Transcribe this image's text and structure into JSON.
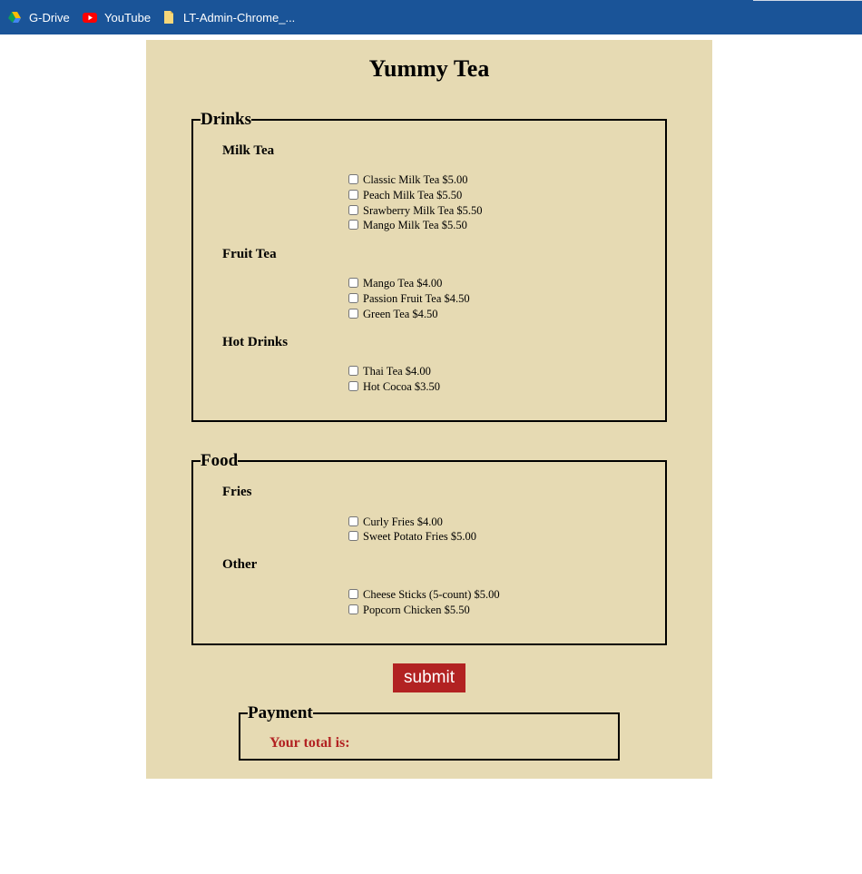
{
  "bookmarks": [
    {
      "label": "G-Drive",
      "icon": "google-drive-icon"
    },
    {
      "label": "YouTube",
      "icon": "youtube-icon"
    },
    {
      "label": "LT-Admin-Chrome_...",
      "icon": "file-icon"
    }
  ],
  "colors": {
    "bookmarks_bar": "#1a5498",
    "panel_background": "#e6dab3",
    "accent": "#b22222"
  },
  "page": {
    "title": "Yummy Tea"
  },
  "drinks": {
    "legend": "Drinks",
    "groups": [
      {
        "title": "Milk Tea",
        "items": [
          {
            "label": "Classic Milk Tea $5.00",
            "checked": false
          },
          {
            "label": "Peach Milk Tea $5.50",
            "checked": false
          },
          {
            "label": "Srawberry Milk Tea $5.50",
            "checked": false
          },
          {
            "label": "Mango Milk Tea $5.50",
            "checked": false
          }
        ]
      },
      {
        "title": "Fruit Tea",
        "items": [
          {
            "label": "Mango Tea $4.00",
            "checked": false
          },
          {
            "label": "Passion Fruit Tea $4.50",
            "checked": false
          },
          {
            "label": "Green Tea $4.50",
            "checked": false
          }
        ]
      },
      {
        "title": "Hot Drinks",
        "items": [
          {
            "label": "Thai Tea $4.00",
            "checked": false
          },
          {
            "label": "Hot Cocoa $3.50",
            "checked": false
          }
        ]
      }
    ]
  },
  "food": {
    "legend": "Food",
    "groups": [
      {
        "title": "Fries",
        "items": [
          {
            "label": "Curly Fries $4.00",
            "checked": false
          },
          {
            "label": "Sweet Potato Fries $5.00",
            "checked": false
          }
        ]
      },
      {
        "title": "Other",
        "items": [
          {
            "label": "Cheese Sticks (5-count) $5.00",
            "checked": false
          },
          {
            "label": "Popcorn Chicken $5.50",
            "checked": false
          }
        ]
      }
    ]
  },
  "submit": {
    "label": "submit"
  },
  "payment": {
    "legend": "Payment",
    "total_label": "Your total is:"
  }
}
